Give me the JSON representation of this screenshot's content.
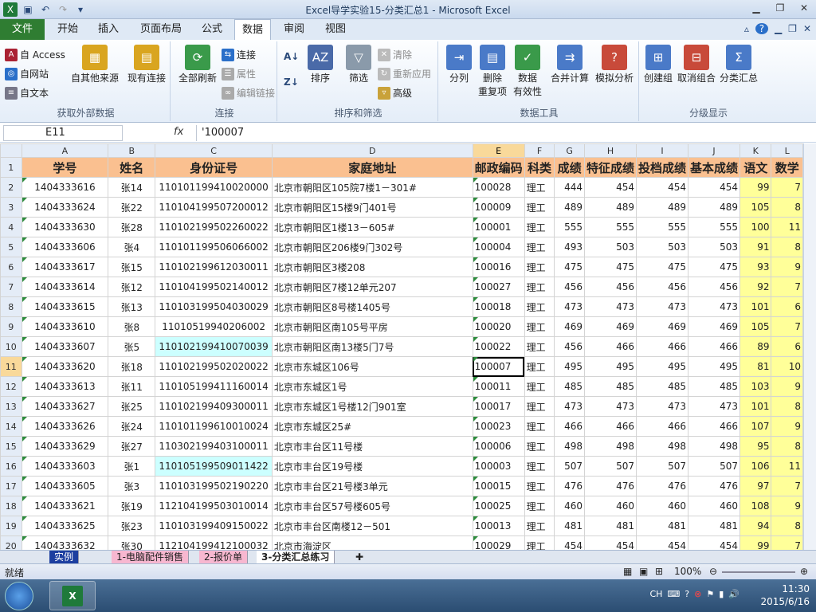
{
  "window": {
    "title": "Excel导学实验15-分类汇总1 - Microsoft Excel"
  },
  "ribbon_tabs": {
    "file": "文件",
    "tabs": [
      "开始",
      "插入",
      "页面布局",
      "公式",
      "数据",
      "审阅",
      "视图"
    ],
    "active": "数据"
  },
  "groups": {
    "external": {
      "label": "获取外部数据",
      "access": "自 Access",
      "web": "自网站",
      "text": "自文本",
      "other": "自其他来源",
      "existing": "现有连接"
    },
    "conn": {
      "label": "连接",
      "refresh": "全部刷新",
      "connections": "连接",
      "props": "属性",
      "editlinks": "编辑链接"
    },
    "sort": {
      "label": "排序和筛选",
      "az": "A↓",
      "sort": "排序",
      "filter": "筛选",
      "clear": "清除",
      "reapply": "重新应用",
      "advanced": "高级"
    },
    "tools": {
      "label": "数据工具",
      "split": "分列",
      "remove1": "删除",
      "remove2": "重复项",
      "valid1": "数据",
      "valid2": "有效性",
      "consol": "合并计算",
      "whatif": "模拟分析"
    },
    "outline": {
      "label": "分级显示",
      "group": "创建组",
      "ungroup": "取消组合",
      "subtotal": "分类汇总"
    }
  },
  "formula_bar": {
    "name_box": "E11",
    "fx": "fx",
    "formula": "'100007"
  },
  "columns": [
    "A",
    "B",
    "C",
    "D",
    "E",
    "F",
    "G",
    "H",
    "I",
    "J",
    "K",
    "L"
  ],
  "headers": [
    "学号",
    "姓名",
    "身份证号",
    "家庭地址",
    "邮政编码",
    "科类",
    "成绩",
    "特征成绩",
    "投档成绩",
    "基本成绩",
    "语文",
    "数学"
  ],
  "rows": [
    {
      "n": "2",
      "id": "1404333616",
      "name": "张14",
      "sfz": "110101199410020000",
      "addr": "北京市朝阳区105院7楼1－301#",
      "zip": "100028",
      "kl": "理工",
      "cj": "444",
      "tz": "454",
      "td": "454",
      "jb": "454",
      "yw": "99",
      "sx": "7"
    },
    {
      "n": "3",
      "id": "1404333624",
      "name": "张22",
      "sfz": "110104199507200012",
      "addr": "北京市朝阳区15楼9门401号",
      "zip": "100009",
      "kl": "理工",
      "cj": "489",
      "tz": "489",
      "td": "489",
      "jb": "489",
      "yw": "105",
      "sx": "8"
    },
    {
      "n": "4",
      "id": "1404333630",
      "name": "张28",
      "sfz": "110102199502260022",
      "addr": "北京市朝阳区1楼13－605#",
      "zip": "100001",
      "kl": "理工",
      "cj": "555",
      "tz": "555",
      "td": "555",
      "jb": "555",
      "yw": "100",
      "sx": "11"
    },
    {
      "n": "5",
      "id": "1404333606",
      "name": "张4",
      "sfz": "110101199506066002",
      "addr": "北京市朝阳区206楼9门302号",
      "zip": "100004",
      "kl": "理工",
      "cj": "493",
      "tz": "503",
      "td": "503",
      "jb": "503",
      "yw": "91",
      "sx": "8"
    },
    {
      "n": "6",
      "id": "1404333617",
      "name": "张15",
      "sfz": "110102199612030011",
      "addr": "北京市朝阳区3楼208",
      "zip": "100016",
      "kl": "理工",
      "cj": "475",
      "tz": "475",
      "td": "475",
      "jb": "475",
      "yw": "93",
      "sx": "9"
    },
    {
      "n": "7",
      "id": "1404333614",
      "name": "张12",
      "sfz": "110104199502140012",
      "addr": "北京市朝阳区7楼12单元207",
      "zip": "100027",
      "kl": "理工",
      "cj": "456",
      "tz": "456",
      "td": "456",
      "jb": "456",
      "yw": "92",
      "sx": "7"
    },
    {
      "n": "8",
      "id": "1404333615",
      "name": "张13",
      "sfz": "110103199504030029",
      "addr": "北京市朝阳区8号楼1405号",
      "zip": "100018",
      "kl": "理工",
      "cj": "473",
      "tz": "473",
      "td": "473",
      "jb": "473",
      "yw": "101",
      "sx": "6"
    },
    {
      "n": "9",
      "id": "1404333610",
      "name": "张8",
      "sfz": "11010519940206002",
      "addr": "北京市朝阳区南105号平房",
      "zip": "100020",
      "kl": "理工",
      "cj": "469",
      "tz": "469",
      "td": "469",
      "jb": "469",
      "yw": "105",
      "sx": "7"
    },
    {
      "n": "10",
      "id": "1404333607",
      "name": "张5",
      "sfz": "110102199410070039",
      "addr": "北京市朝阳区南13楼5门7号",
      "zip": "100022",
      "kl": "理工",
      "cj": "456",
      "tz": "466",
      "td": "466",
      "jb": "466",
      "yw": "89",
      "sx": "6"
    },
    {
      "n": "11",
      "id": "1404333620",
      "name": "张18",
      "sfz": "110102199502020022",
      "addr": "北京市东城区106号",
      "zip": "100007",
      "kl": "理工",
      "cj": "495",
      "tz": "495",
      "td": "495",
      "jb": "495",
      "yw": "81",
      "sx": "10"
    },
    {
      "n": "12",
      "id": "1404333613",
      "name": "张11",
      "sfz": "110105199411160014",
      "addr": "北京市东城区1号",
      "zip": "100011",
      "kl": "理工",
      "cj": "485",
      "tz": "485",
      "td": "485",
      "jb": "485",
      "yw": "103",
      "sx": "9"
    },
    {
      "n": "13",
      "id": "1404333627",
      "name": "张25",
      "sfz": "110102199409300011",
      "addr": "北京市东城区1号楼12门901室",
      "zip": "100017",
      "kl": "理工",
      "cj": "473",
      "tz": "473",
      "td": "473",
      "jb": "473",
      "yw": "101",
      "sx": "8"
    },
    {
      "n": "14",
      "id": "1404333626",
      "name": "张24",
      "sfz": "110101199610010024",
      "addr": "北京市东城区25#",
      "zip": "100023",
      "kl": "理工",
      "cj": "466",
      "tz": "466",
      "td": "466",
      "jb": "466",
      "yw": "107",
      "sx": "9"
    },
    {
      "n": "15",
      "id": "1404333629",
      "name": "张27",
      "sfz": "110302199403100011",
      "addr": "北京市丰台区11号楼",
      "zip": "100006",
      "kl": "理工",
      "cj": "498",
      "tz": "498",
      "td": "498",
      "jb": "498",
      "yw": "95",
      "sx": "8"
    },
    {
      "n": "16",
      "id": "1404333603",
      "name": "张1",
      "sfz": "110105199509011422",
      "addr": "北京市丰台区19号楼",
      "zip": "100003",
      "kl": "理工",
      "cj": "507",
      "tz": "507",
      "td": "507",
      "jb": "507",
      "yw": "106",
      "sx": "11"
    },
    {
      "n": "17",
      "id": "1404333605",
      "name": "张3",
      "sfz": "110103199502190220",
      "addr": "北京市丰台区21号楼3单元",
      "zip": "100015",
      "kl": "理工",
      "cj": "476",
      "tz": "476",
      "td": "476",
      "jb": "476",
      "yw": "97",
      "sx": "7"
    },
    {
      "n": "18",
      "id": "1404333621",
      "name": "张19",
      "sfz": "112104199503010014",
      "addr": "北京市丰台区57号楼605号",
      "zip": "100025",
      "kl": "理工",
      "cj": "460",
      "tz": "460",
      "td": "460",
      "jb": "460",
      "yw": "108",
      "sx": "9"
    },
    {
      "n": "19",
      "id": "1404333625",
      "name": "张23",
      "sfz": "110103199409150022",
      "addr": "北京市丰台区南楼12－501",
      "zip": "100013",
      "kl": "理工",
      "cj": "481",
      "tz": "481",
      "td": "481",
      "jb": "481",
      "yw": "94",
      "sx": "8"
    },
    {
      "n": "20",
      "id": "1404333632",
      "name": "张30",
      "sfz": "112104199412100032",
      "addr": "北京市海淀区",
      "zip": "100029",
      "kl": "理工",
      "cj": "454",
      "tz": "454",
      "td": "454",
      "jb": "454",
      "yw": "99",
      "sx": "7"
    }
  ],
  "sheet_tabs": [
    "实例",
    "1-电脑配件销售",
    "2-报价单",
    "3-分类汇总练习"
  ],
  "status": {
    "ready": "就绪",
    "zoom": "100%"
  },
  "tray": {
    "time": "11:30",
    "date": "2015/6/16",
    "lang": "CH"
  }
}
